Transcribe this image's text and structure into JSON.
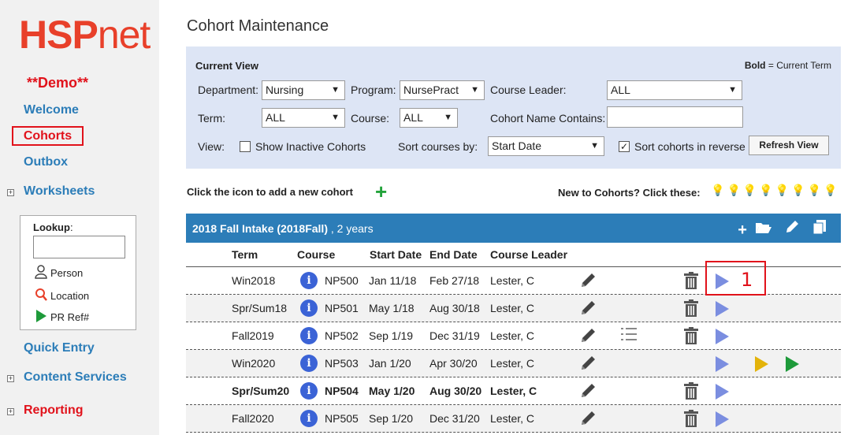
{
  "sidebar": {
    "logo_hsp": "HSP",
    "logo_net": "net",
    "demo": "**Demo**",
    "welcome": "Welcome",
    "cohorts": "Cohorts",
    "outbox": "Outbox",
    "worksheets": "Worksheets",
    "lookup_label": "Lookup",
    "lookup_colon": ":",
    "lookup_person": "Person",
    "lookup_location": "Location",
    "lookup_pr": "PR Ref#",
    "quick_entry": "Quick Entry",
    "content_services": "Content Services",
    "reporting": "Reporting"
  },
  "page": {
    "title": "Cohort Maintenance"
  },
  "filters": {
    "current_view": "Current View",
    "legend_bold": "Bold",
    "legend_text": " = Current Term",
    "department_label": "Department:",
    "department_value": "Nursing",
    "program_label": "Program:",
    "program_value": "NursePract",
    "course_leader_label": "Course Leader:",
    "course_leader_value": "ALL",
    "term_label": "Term:",
    "term_value": "ALL",
    "course_label": "Course:",
    "course_value": "ALL",
    "name_contains_label": "Cohort Name Contains:",
    "view_label": "View:",
    "show_inactive": "Show Inactive Cohorts",
    "sort_by_label": "Sort courses by:",
    "sort_by_value": "Start Date",
    "sort_reverse": "Sort cohorts in reverse",
    "refresh": "Refresh View"
  },
  "actions": {
    "add_text": "Click the icon to add a new cohort",
    "new_to": "New to Cohorts? Click these:"
  },
  "cohort": {
    "name": "2018 Fall Intake (2018Fall)",
    "duration": " , 2 years",
    "columns": [
      "Term",
      "Course",
      "Start Date",
      "End Date",
      "Course Leader"
    ],
    "rows": [
      {
        "term": "Win2018",
        "course": "NP500",
        "start": "Jan 11/18",
        "end": "Feb 27/18",
        "leader": "Lester, C"
      },
      {
        "term": "Spr/Sum18",
        "course": "NP501",
        "start": "May 1/18",
        "end": "Aug 30/18",
        "leader": "Lester, C"
      },
      {
        "term": "Fall2019",
        "course": "NP502",
        "start": "Sep 1/19",
        "end": "Dec 31/19",
        "leader": "Lester, C"
      },
      {
        "term": "Win2020",
        "course": "NP503",
        "start": "Jan 1/20",
        "end": "Apr 30/20",
        "leader": "Lester, C"
      },
      {
        "term": "Spr/Sum20",
        "course": "NP504",
        "start": "May 1/20",
        "end": "Aug 30/20",
        "leader": "Lester, C"
      },
      {
        "term": "Fall2020",
        "course": "NP505",
        "start": "Sep 1/20",
        "end": "Dec 31/20",
        "leader": "Lester, C"
      }
    ]
  },
  "annotation": {
    "number": "1"
  },
  "colors": {
    "brand_blue": "#2c7db8",
    "brand_red": "#e1121b",
    "accent_green": "#23a33b"
  }
}
